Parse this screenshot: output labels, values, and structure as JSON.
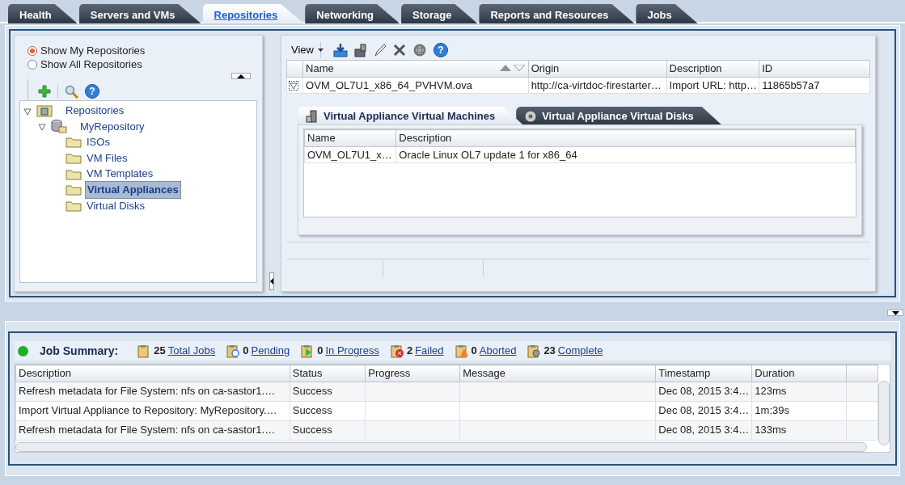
{
  "tabs": [
    {
      "label": "Health",
      "selected": false
    },
    {
      "label": "Servers and VMs",
      "selected": false
    },
    {
      "label": "Repositories",
      "selected": true
    },
    {
      "label": "Networking",
      "selected": false
    },
    {
      "label": "Storage",
      "selected": false
    },
    {
      "label": "Reports and Resources",
      "selected": false
    },
    {
      "label": "Jobs",
      "selected": false
    }
  ],
  "repository_filter": [
    {
      "label": "Show My Repositories",
      "selected": true
    },
    {
      "label": "Show All Repositories",
      "selected": false
    }
  ],
  "tree": [
    {
      "label": "Repositories",
      "kind": "root",
      "expanded": true,
      "selected": false,
      "children": [
        {
          "label": "MyRepository",
          "kind": "repository",
          "expanded": true,
          "selected": false,
          "children": [
            {
              "label": "ISOs",
              "kind": "folder",
              "selected": false
            },
            {
              "label": "VM Files",
              "kind": "folder",
              "selected": false
            },
            {
              "label": "VM Templates",
              "kind": "folder",
              "selected": false
            },
            {
              "label": "Virtual Appliances",
              "kind": "folder",
              "selected": true
            },
            {
              "label": "Virtual Disks",
              "kind": "folder",
              "selected": false
            }
          ]
        }
      ]
    }
  ],
  "tree_toolbar": {
    "help_icon": "?"
  },
  "appliance_toolbar": {
    "view_menu": "View",
    "help_icon": "?"
  },
  "appliance_table": {
    "columns": [
      "Name",
      "Origin",
      "Description",
      "ID"
    ],
    "rows": [
      {
        "cells": [
          "OVM_OL7U1_x86_64_PVHVM.ova",
          "http://ca-virtdoc-firestarter…",
          "Import URL: http…",
          "11865b57a7"
        ],
        "expanded": true
      }
    ]
  },
  "detail_tabs": [
    {
      "label": "Virtual Appliance Virtual Machines",
      "kind": "machines",
      "selected": true
    },
    {
      "label": "Virtual Appliance Virtual Disks",
      "kind": "disks",
      "selected": false
    }
  ],
  "detail_table": {
    "columns": [
      "Name",
      "Description"
    ],
    "rows": [
      [
        "OVM_OL7U1_x…",
        "Oracle Linux OL7 update 1 for x86_64"
      ]
    ]
  },
  "job_summary": {
    "title": "Job Summary:",
    "counts": [
      {
        "kind": "total",
        "count": "25",
        "label": "Total Jobs"
      },
      {
        "kind": "pending",
        "count": "0",
        "label": "Pending"
      },
      {
        "kind": "progress",
        "count": "0",
        "label": "In Progress"
      },
      {
        "kind": "failed",
        "count": "2",
        "label": "Failed"
      },
      {
        "kind": "aborted",
        "count": "0",
        "label": "Aborted"
      },
      {
        "kind": "complete",
        "count": "23",
        "label": "Complete"
      }
    ]
  },
  "jobs_table": {
    "columns": [
      "Description",
      "Status",
      "Progress",
      "Message",
      "Timestamp",
      "Duration"
    ],
    "rows": [
      [
        "Refresh metadata for File System: nfs on ca-sastor1.…",
        "Success",
        "",
        "",
        "Dec 08, 2015 3:4…",
        "123ms"
      ],
      [
        "Import Virtual Appliance to Repository: MyRepository.…",
        "Success",
        "",
        "",
        "Dec 08, 2015 3:4…",
        "1m:39s"
      ],
      [
        "Refresh metadata for File System: nfs on ca-sastor1.…",
        "Success",
        "",
        "",
        "Dec 08, 2015 3:4…",
        "133ms"
      ]
    ]
  }
}
